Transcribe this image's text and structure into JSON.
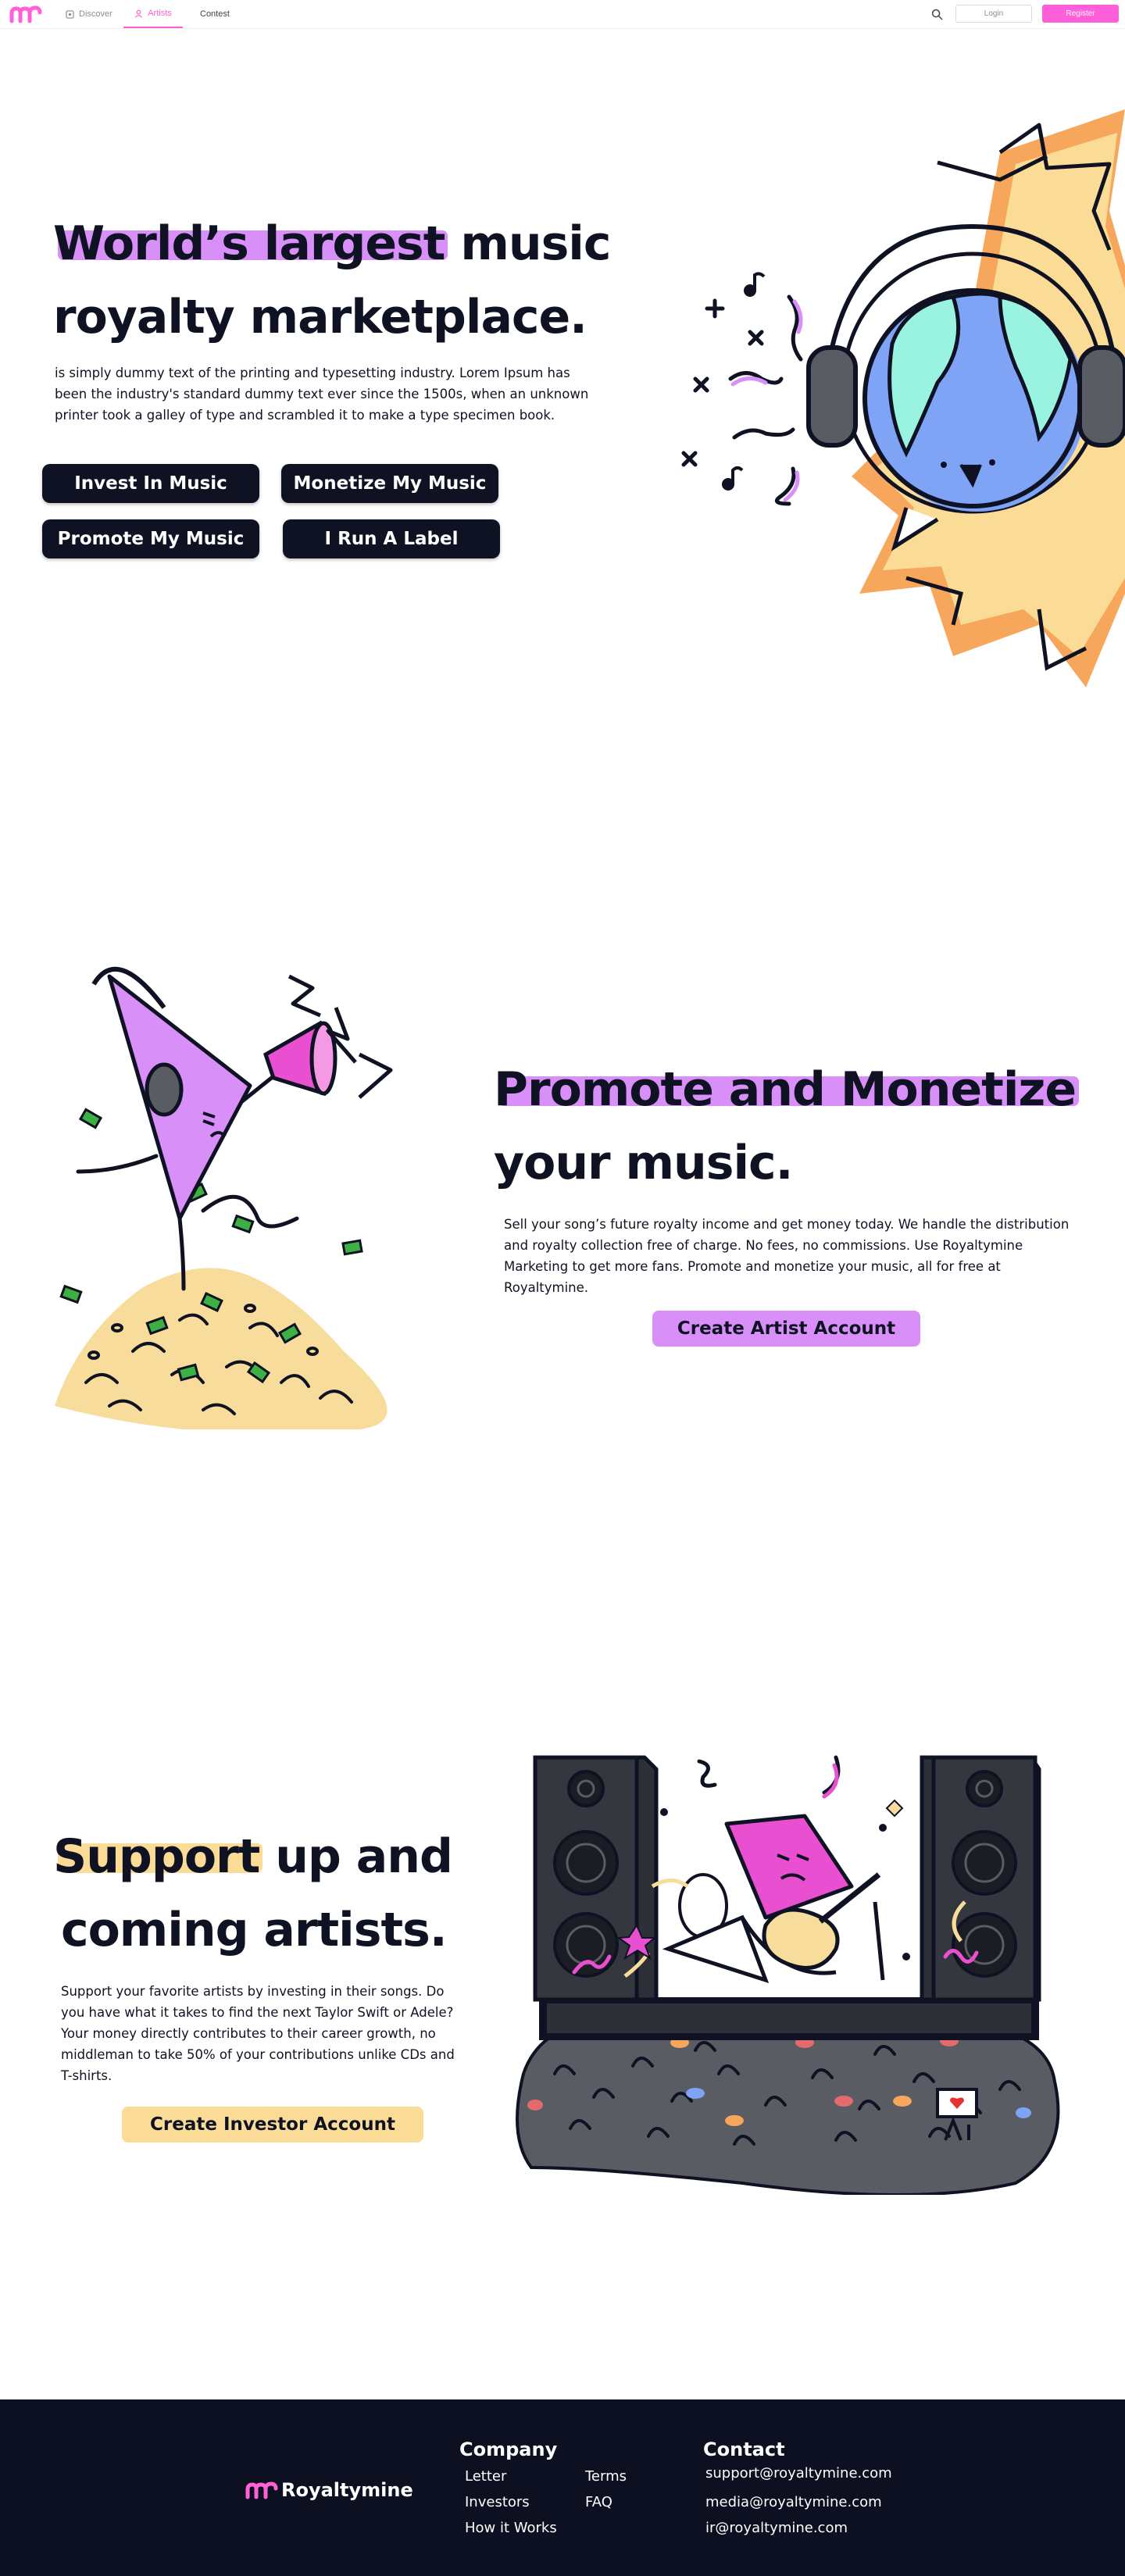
{
  "nav": {
    "tabs": [
      {
        "label": "Discover",
        "icon": "compass-icon"
      },
      {
        "label": "Artists",
        "icon": "user-icon"
      },
      {
        "label": "Contest",
        "icon": ""
      }
    ],
    "login_label": "Login",
    "register_label": "Register"
  },
  "hero": {
    "title_highlight": "World’s largest",
    "title_rest": " music",
    "title_line2": "royalty marketplace.",
    "body": " is simply dummy text of the printing and typesetting industry. Lorem Ipsum has been the industry's standard dummy text ever since the 1500s, when an unknown printer took a galley of type and scrambled it to make a type specimen book.",
    "buttons": [
      "Invest In Music",
      "Monetize My Music",
      "Promote My Music",
      "I Run A Label"
    ]
  },
  "promote": {
    "title_highlight": "Promote and Monetize",
    "title_line2": "your music.",
    "body": "Sell your song’s future royalty income and get money today. We handle the distribution and royalty collection free of charge. No fees, no commissions. Use Royaltymine Marketing to get more fans. Promote and monetize your music, all for free at Royaltymine.",
    "cta": "Create Artist Account"
  },
  "support": {
    "title_highlight": "Support",
    "title_rest": " up and",
    "title_line2": "coming artists.",
    "body": "Support your favorite artists by investing in their songs. Do you have what it takes to find the next Taylor Swift or Adele? Your money directly contributes to their career growth, no middleman to take 50% of your contributions unlike CDs and T-shirts.",
    "cta": "Create Investor Account"
  },
  "footer": {
    "brand": "Royaltymine",
    "company_heading": "Company",
    "company_links": [
      "Letter",
      "Investors",
      "How it Works",
      "Terms",
      "FAQ"
    ],
    "contact_heading": "Contact",
    "contact_emails": [
      "support@royaltymine.com",
      "media@royaltymine.com",
      "ir@royaltymine.com"
    ]
  },
  "colors": {
    "brand_pink": "#ff5fd8",
    "navy": "#0f1222",
    "purple_highlight": "#d88ff7",
    "yellow_highlight": "#fbdc97",
    "footer_bg": "#0d1020"
  }
}
